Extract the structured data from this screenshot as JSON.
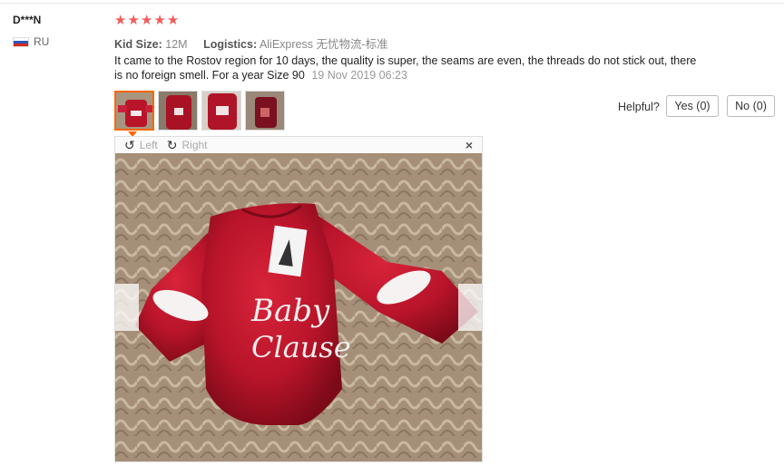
{
  "reviewer": {
    "name": "D***N",
    "country": "RU"
  },
  "rating": {
    "stars": 5
  },
  "meta": {
    "kid_size_label": "Kid Size:",
    "kid_size_value": "12M",
    "logistics_label": "Logistics:",
    "logistics_value": "AliExpress 无忧物流-标准"
  },
  "review": {
    "text": "It came to the Rostov region for 10 days, the quality is super, the seams are even, the threads do not stick out, there is no foreign smell. For a year Size 90",
    "date": "19 Nov 2019 06:23"
  },
  "helpful": {
    "label": "Helpful?",
    "yes": "Yes (0)",
    "no": "No (0)"
  },
  "viewer": {
    "left_label": "Left",
    "right_label": "Right",
    "close_icon": "×"
  },
  "photo": {
    "print_line1": "Baby",
    "print_line2": "Clause"
  },
  "colors": {
    "star": "#f25b5b",
    "accent": "#ff6600",
    "garment": "#b8142a"
  }
}
